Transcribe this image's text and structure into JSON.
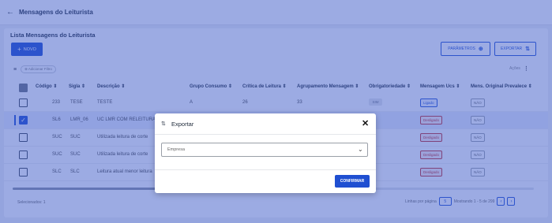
{
  "topbar": {
    "back_icon": "arrow-left-icon",
    "title": "Mensagens do Leiturista"
  },
  "card": {
    "title": "Lista Mensagens do Leiturista",
    "novo_label": "NOVO",
    "parametros_label": "PARÂMETROS",
    "exportar_label": "EXPORTAR",
    "filter_chip": "Adicionar Filtro",
    "acoes_label": "Ações"
  },
  "table": {
    "headers": [
      "Código",
      "Sigla",
      "Descrição",
      "Grupo Consumo",
      "Crítica de Leitura",
      "Agrupamento Mensagem",
      "Obrigatoriedade",
      "Mensagem Ucs",
      "Mens. Original Prevalece"
    ],
    "rows": [
      {
        "codigo": "233",
        "sigla": "TESE",
        "descricao": "TESTE",
        "grupo": "A",
        "critica": "26",
        "agrupamento": "33",
        "obrig": "SIM",
        "msg_ucs": "Ligado",
        "mens_orig": "NÃO",
        "selected": false
      },
      {
        "codigo": "SL6",
        "sigla": "LMR_06",
        "descricao": "UC LMR COM RELEITURA",
        "grupo": "",
        "critica": "",
        "agrupamento": "",
        "obrig": "",
        "msg_ucs": "Desligado",
        "mens_orig": "NÃO",
        "selected": true
      },
      {
        "codigo": "SUC",
        "sigla": "SUC",
        "descricao": "Utilizada leitura de corte",
        "grupo": "",
        "critica": "",
        "agrupamento": "",
        "obrig": "",
        "msg_ucs": "Desligado",
        "mens_orig": "NÃO",
        "selected": false
      },
      {
        "codigo": "SUC",
        "sigla": "SUC",
        "descricao": "Utilizada leitura de corte",
        "grupo": "",
        "critica": "",
        "agrupamento": "",
        "obrig": "",
        "msg_ucs": "Desligado",
        "mens_orig": "NÃO",
        "selected": false
      },
      {
        "codigo": "SLC",
        "sigla": "SLC",
        "descricao": "Leitura atual menor leitura",
        "grupo": "",
        "critica": "",
        "agrupamento": "",
        "obrig": "",
        "msg_ucs": "Desligado",
        "mens_orig": "NÃO",
        "selected": false
      }
    ]
  },
  "footer": {
    "selected_text": "Selecionados: 1",
    "rows_per_page_label": "Linhas por página",
    "rows_per_page_value": "5",
    "range_text": "Mostrando 1 - 5 de 299"
  },
  "modal": {
    "title": "Exportar",
    "select_placeholder": "Empresa",
    "confirm_label": "CONFIRMAR"
  },
  "colors": {
    "primary": "#1f4fd1",
    "danger": "#c53030",
    "overlay": "#3a58c8"
  }
}
